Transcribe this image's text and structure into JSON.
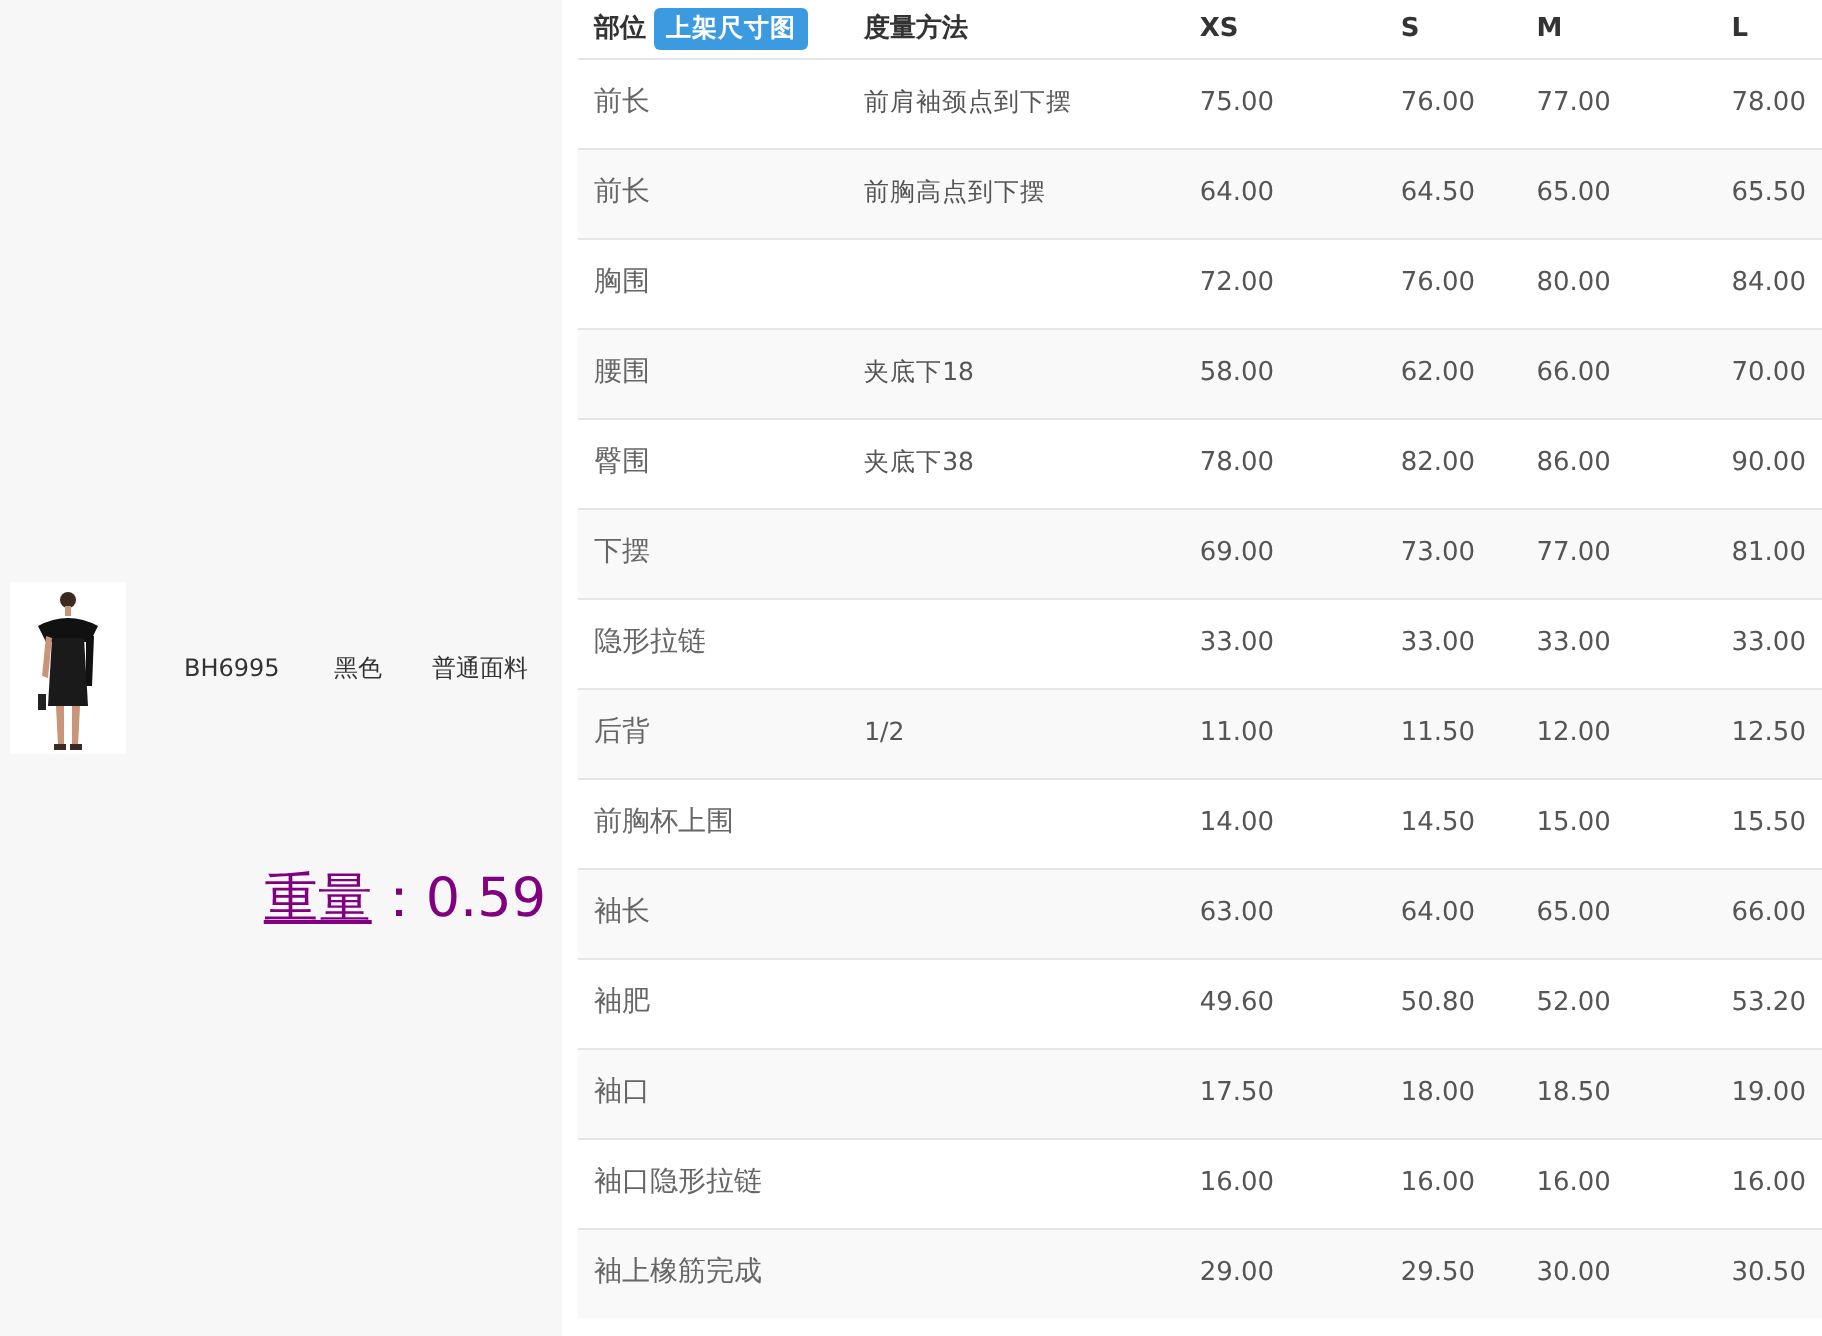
{
  "product": {
    "code": "BH6995",
    "color_name": "黑色",
    "fabric": "普通面料",
    "weight_label": "重量",
    "weight_value": "：0.59"
  },
  "table": {
    "columns": [
      "部位",
      "度量方法",
      "XS",
      "S",
      "M",
      "L"
    ],
    "header_button": "上架尺寸图",
    "rows": [
      {
        "part": "前长",
        "method": "前肩袖颈点到下摆",
        "values": [
          "75.00",
          "76.00",
          "77.00",
          "78.00"
        ]
      },
      {
        "part": "前长",
        "method": "前胸高点到下摆",
        "values": [
          "64.00",
          "64.50",
          "65.00",
          "65.50"
        ]
      },
      {
        "part": "胸围",
        "values": [
          "72.00",
          "76.00",
          "80.00",
          "84.00"
        ]
      },
      {
        "part": "腰围",
        "method": "夹底下18",
        "values": [
          "58.00",
          "62.00",
          "66.00",
          "70.00"
        ]
      },
      {
        "part": "臀围",
        "method": "夹底下38",
        "values": [
          "78.00",
          "82.00",
          "86.00",
          "90.00"
        ]
      },
      {
        "part": "下摆",
        "values": [
          "69.00",
          "73.00",
          "77.00",
          "81.00"
        ]
      },
      {
        "part": "隐形拉链",
        "values": [
          "33.00",
          "33.00",
          "33.00",
          "33.00"
        ]
      },
      {
        "part": "后背",
        "method": "1/2",
        "values": [
          "11.00",
          "11.50",
          "12.00",
          "12.50"
        ]
      },
      {
        "part": "前胸杯上围",
        "values": [
          "14.00",
          "14.50",
          "15.00",
          "15.50"
        ]
      },
      {
        "part": "袖长",
        "values": [
          "63.00",
          "64.00",
          "65.00",
          "66.00"
        ]
      },
      {
        "part": "袖肥",
        "values": [
          "49.60",
          "50.80",
          "52.00",
          "53.20"
        ]
      },
      {
        "part": "袖口",
        "values": [
          "17.50",
          "18.00",
          "18.50",
          "19.00"
        ]
      },
      {
        "part": "袖口隐形拉链",
        "values": [
          "16.00",
          "16.00",
          "16.00",
          "16.00"
        ]
      },
      {
        "part": "袖上橡筋完成",
        "values": [
          "29.00",
          "29.50",
          "30.00",
          "30.50"
        ]
      }
    ]
  }
}
